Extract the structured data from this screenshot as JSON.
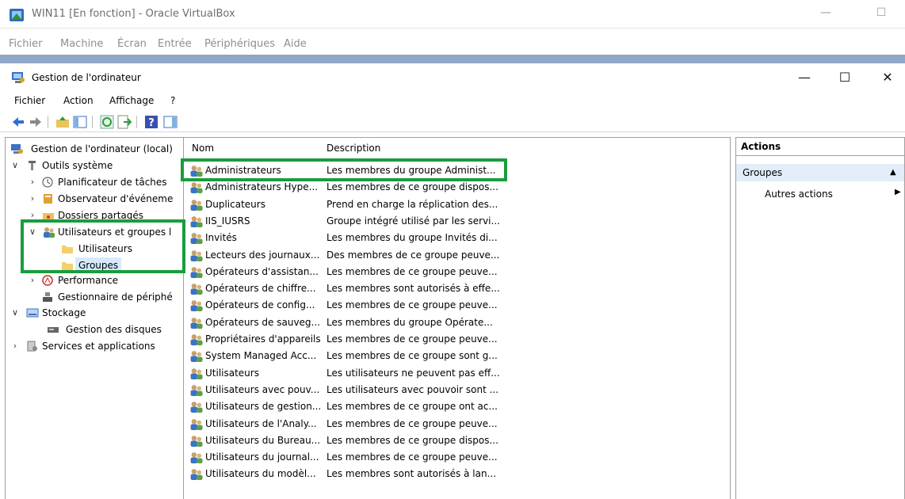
{
  "vbox": {
    "title": "WIN11 [En fonction] - Oracle VirtualBox",
    "menu": [
      "Fichier",
      "Machine",
      "Écran",
      "Entrée",
      "Périphériques",
      "Aide"
    ],
    "minimize": "—",
    "maximize": "☐"
  },
  "window": {
    "title": "Gestion de l'ordinateur",
    "minimize": "—",
    "maximize": "☐",
    "close": "✕",
    "menu": [
      "Fichier",
      "Action",
      "Affichage",
      "?"
    ]
  },
  "tree": {
    "root": "Gestion de l'ordinateur (local)",
    "outils": "Outils système",
    "planificateur": "Planificateur de tâches",
    "observateur": "Observateur d'événeme",
    "dossiers": "Dossiers partagés",
    "utilisateurs_groupes": "Utilisateurs et groupes l",
    "utilisateurs": "Utilisateurs",
    "groupes": "Groupes",
    "performance": "Performance",
    "gestionnaire": "Gestionnaire de périphé",
    "stockage": "Stockage",
    "disques": "Gestion des disques",
    "services": "Services et applications",
    "expanded": "∨",
    "collapsed": "›"
  },
  "list": {
    "col_name": "Nom",
    "col_desc": "Description",
    "rows": [
      {
        "name": "Administrateurs",
        "desc": "Les membres du groupe Administ..."
      },
      {
        "name": "Administrateurs Hype...",
        "desc": "Les membres de ce groupe dispos..."
      },
      {
        "name": "Duplicateurs",
        "desc": "Prend en charge la réplication des..."
      },
      {
        "name": "IIS_IUSRS",
        "desc": "Groupe intégré utilisé par les servi..."
      },
      {
        "name": "Invités",
        "desc": "Les membres du groupe Invités di..."
      },
      {
        "name": "Lecteurs des journaux...",
        "desc": "Des membres de ce groupe peuve..."
      },
      {
        "name": "Opérateurs d'assistan...",
        "desc": "Les membres de ce groupe peuve..."
      },
      {
        "name": "Opérateurs de chiffre...",
        "desc": "Les membres sont autorisés à effe..."
      },
      {
        "name": "Opérateurs de config...",
        "desc": "Les membres de ce groupe peuve..."
      },
      {
        "name": "Opérateurs de sauveg...",
        "desc": "Les membres du groupe Opérate..."
      },
      {
        "name": "Propriétaires d'appareils",
        "desc": "Les membres de ce groupe peuve..."
      },
      {
        "name": "System Managed Acc...",
        "desc": "Les membres de ce groupe sont g..."
      },
      {
        "name": "Utilisateurs",
        "desc": "Les utilisateurs ne peuvent pas eff..."
      },
      {
        "name": "Utilisateurs avec pouv...",
        "desc": "Les utilisateurs avec pouvoir sont ..."
      },
      {
        "name": "Utilisateurs de gestion...",
        "desc": "Les membres de ce groupe ont ac..."
      },
      {
        "name": "Utilisateurs de l'Analy...",
        "desc": "Les membres de ce groupe peuve..."
      },
      {
        "name": "Utilisateurs du Bureau...",
        "desc": "Les membres de ce groupe dispos..."
      },
      {
        "name": "Utilisateurs du journal...",
        "desc": "Les membres de ce groupe peuve..."
      },
      {
        "name": "Utilisateurs du modèl...",
        "desc": "Les membres sont autorisés à lan..."
      }
    ]
  },
  "actions": {
    "header": "Actions",
    "group": "Groupes",
    "group_arrow": "▲",
    "item": "Autres actions",
    "item_arrow": "▶"
  },
  "colors": {
    "highlight": "#1a9c3c",
    "selection": "#d6e9ff",
    "action_group_bg": "#e3edf9",
    "vbox_strip": "#8fa7c7"
  }
}
